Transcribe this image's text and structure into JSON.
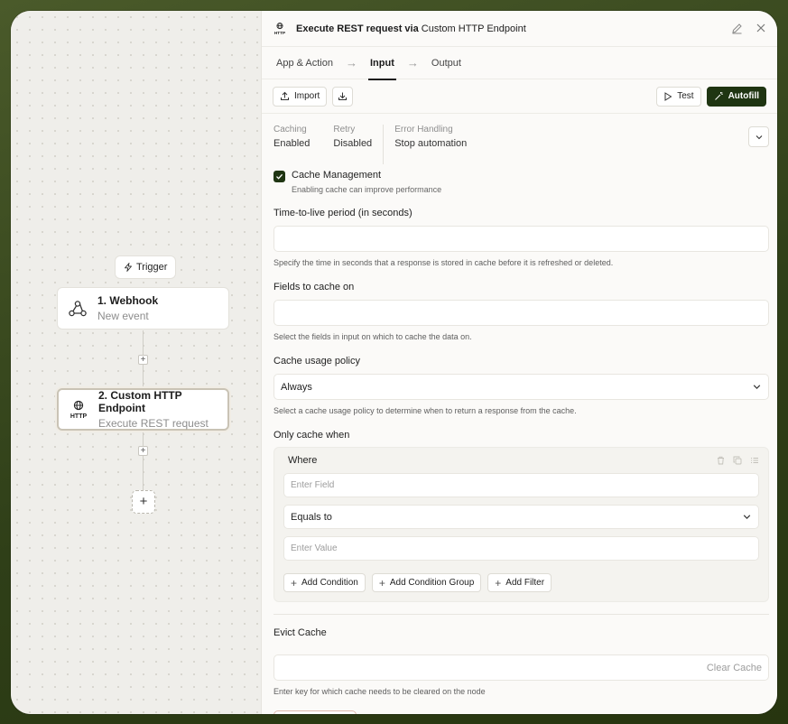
{
  "canvas": {
    "trigger_label": "Trigger",
    "nodes": [
      {
        "title": "1. Webhook",
        "subtitle": "New event"
      },
      {
        "title": "2. Custom HTTP Endpoint",
        "subtitle": "Execute REST request"
      }
    ]
  },
  "panel": {
    "title_bold": "Execute REST request via",
    "title_light": "Custom HTTP Endpoint",
    "tabs": [
      "App & Action",
      "Input",
      "Output"
    ],
    "toolbar": {
      "import_label": "Import",
      "test_label": "Test",
      "autofill_label": "Autofill"
    },
    "summary": [
      {
        "key": "Caching",
        "value": "Enabled"
      },
      {
        "key": "Retry",
        "value": "Disabled"
      },
      {
        "key": "Error Handling",
        "value": "Stop automation"
      }
    ],
    "cache_management": {
      "title": "Cache Management",
      "subtitle": "Enabling cache can improve performance"
    },
    "ttl": {
      "label": "Time-to-live period (in seconds)",
      "value": "",
      "hint": "Specify the time in seconds that a response is stored in cache before it is refreshed or deleted."
    },
    "fields_to_cache": {
      "label": "Fields to cache on",
      "value": "",
      "hint": "Select the fields in input on which to cache the data on."
    },
    "usage_policy": {
      "label": "Cache usage policy",
      "value": "Always",
      "hint": "Select a cache usage policy to determine when to return a response from the cache."
    },
    "only_cache_when": {
      "label": "Only cache when",
      "where_label": "Where",
      "field_placeholder": "Enter Field",
      "operator": "Equals to",
      "value_placeholder": "Enter Value",
      "add_condition": "Add Condition",
      "add_condition_group": "Add Condition Group",
      "add_filter": "Add Filter"
    },
    "evict_cache": {
      "label": "Evict Cache",
      "button": "Clear Cache",
      "hint": "Enter key for which cache needs to be cleared on the node"
    }
  }
}
